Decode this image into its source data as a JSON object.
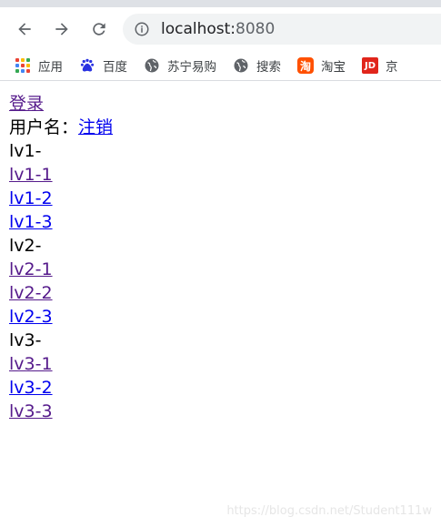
{
  "browser": {
    "url_host": "localhost:",
    "url_port": "8080",
    "bookmarks": [
      {
        "label": "应用",
        "icon": "apps-icon"
      },
      {
        "label": "百度",
        "icon": "baidu-paw-icon"
      },
      {
        "label": "苏宁易购",
        "icon": "globe-icon"
      },
      {
        "label": "搜索",
        "icon": "globe-icon"
      },
      {
        "label": "淘宝",
        "icon": "taobao-icon",
        "icon_text": "淘"
      },
      {
        "label": "京",
        "icon": "jd-icon",
        "icon_text": "JD"
      }
    ]
  },
  "page": {
    "login_link": "登录",
    "username_label": "用户名：",
    "logout_link": "注销",
    "sections": [
      {
        "title": "lv1-",
        "links": [
          "lv1-1",
          "lv1-2",
          "lv1-3"
        ]
      },
      {
        "title": "lv2-",
        "links": [
          "lv2-1",
          "lv2-2",
          "lv2-3"
        ]
      },
      {
        "title": "lv3-",
        "links": [
          "lv3-1",
          "lv3-2",
          "lv3-3"
        ]
      }
    ]
  },
  "watermark": "https://blog.csdn.net/Student111w",
  "colors": {
    "link": "#0000ee",
    "visited": "#551a8b"
  }
}
